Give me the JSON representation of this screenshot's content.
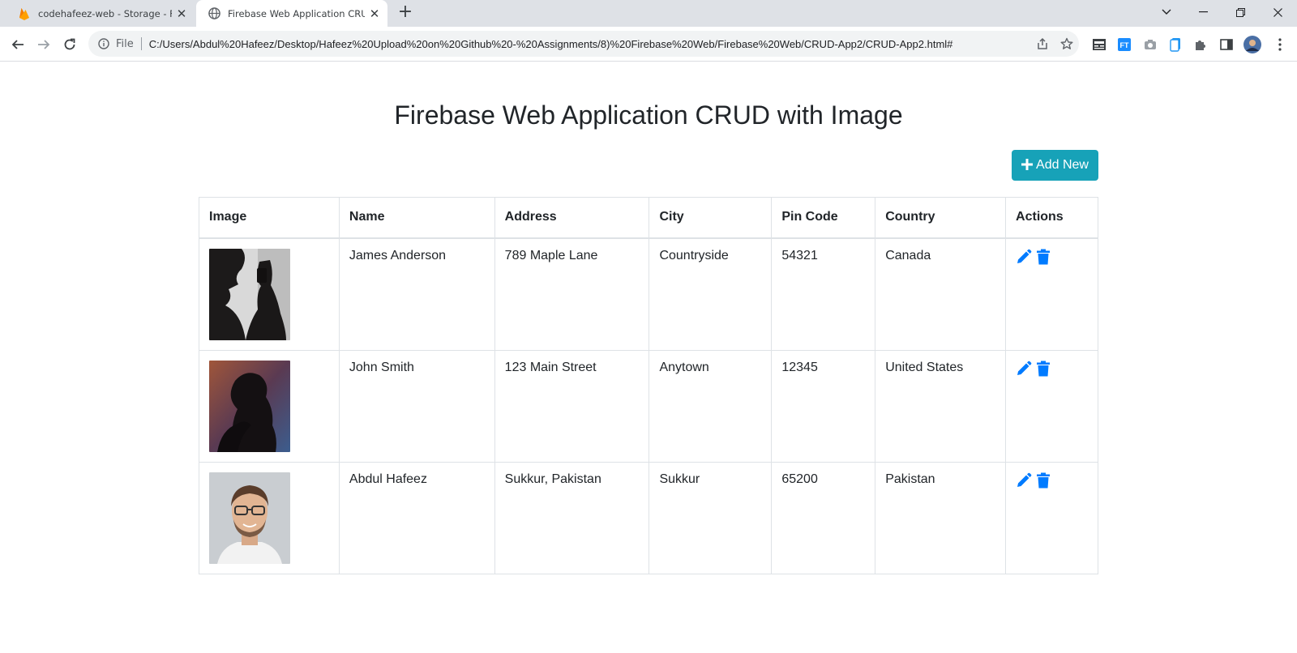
{
  "browser": {
    "tabs": [
      {
        "title": "codehafeez-web - Storage - Fireb",
        "active": false,
        "favicon": "firebase-icon"
      },
      {
        "title": "Firebase Web Application CRUD w",
        "active": true,
        "favicon": "globe-icon"
      }
    ],
    "address": {
      "scheme_label": "File",
      "url": "C:/Users/Abdul%20Hafeez/Desktop/Hafeez%20Upload%20on%20Github%20-%20Assignments/8)%20Firebase%20Web/Firebase%20Web/CRUD-App2/CRUD-App2.html#"
    }
  },
  "page": {
    "title": "Firebase Web Application CRUD with Image",
    "add_button": {
      "icon": "plus-icon",
      "label": "Add New"
    }
  },
  "table": {
    "headers": [
      "Image",
      "Name",
      "Address",
      "City",
      "Pin Code",
      "Country",
      "Actions"
    ],
    "rows": [
      {
        "image": "silhouette-phone-photo",
        "name": "James Anderson",
        "address": "789 Maple Lane",
        "city": "Countryside",
        "pin": "54321",
        "country": "Canada"
      },
      {
        "image": "silhouette-sunset-photo",
        "name": "John Smith",
        "address": "123 Main Street",
        "city": "Anytown",
        "pin": "12345",
        "country": "United States"
      },
      {
        "image": "man-glasses-portrait-photo",
        "name": "Abdul Hafeez",
        "address": "Sukkur, Pakistan",
        "city": "Sukkur",
        "pin": "65200",
        "country": "Pakistan"
      }
    ],
    "action_icons": [
      "pencil-icon",
      "trash-icon"
    ]
  },
  "colors": {
    "accent_info": "#17a2b8",
    "action_blue": "#007bff"
  }
}
